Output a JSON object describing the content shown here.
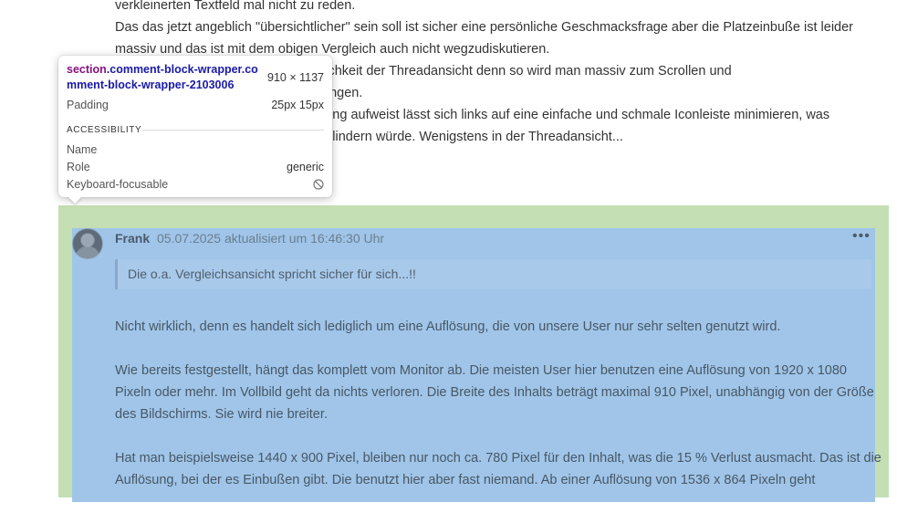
{
  "previous_comment": {
    "lines": [
      "verkleinerten Textfeld mal nicht zu reden.",
      "Das das jetzt angeblich \"übersichtlicher\" sein soll ist sicher eine persönliche Geschmacksfrage aber die Platzeinbuße ist leider",
      "massiv und das ist mit dem obigen Vergleich auch nicht wegzudiskutieren.",
      "lichkeit der Threadansicht denn so wird man massiv zum Scrollen und",
      "ungen.",
      "lung aufweist lässt sich links auf eine einfache und schmale Iconleiste minimieren, was",
      "s lindern würde. Wenigstens in der Threadansicht..."
    ]
  },
  "tooltip": {
    "selector_tag": "section",
    "selector_classes": ".comment-block-wrapper.comment-block-wrapper-2103006",
    "size": "910 × 1137",
    "padding_label": "Padding",
    "padding_value": "25px 15px",
    "accessibility_heading": "ACCESSIBILITY",
    "name_label": "Name",
    "name_value": "",
    "role_label": "Role",
    "role_value": "generic",
    "focusable_label": "Keyboard-focusable",
    "focusable_icon": "not-allowed-icon"
  },
  "comment": {
    "author": "Frank",
    "meta": "05.07.2025 aktualisiert um 16:46:30 Uhr",
    "more_label": "•••",
    "quote": "Die o.a. Vergleichsansicht spricht sicher für sich...!!",
    "paragraphs": [
      "Nicht wirklich, denn es handelt sich lediglich um eine Auflösung, die von unsere User nur sehr selten genutzt wird.",
      "Wie bereits festgestellt, hängt das komplett vom Monitor ab. Die meisten User hier benutzen eine Auflösung von 1920 x 1080 Pixeln oder mehr. Im Vollbild geht da nichts verloren. Die Breite des Inhalts beträgt maximal 910 Pixel, unabhängig von der Größe des Bildschirms. Sie wird nie breiter.",
      "Hat man beispielsweise 1440 x 900 Pixel, bleiben nur noch ca. 780 Pixel für den Inhalt, was die 15 % Verlust ausmacht. Das ist die Auflösung, bei der es Einbußen gibt. Die benutzt hier aber fast niemand. Ab einer Auflösung von 1536 x 864 Pixeln geht"
    ]
  },
  "colors": {
    "margin_highlight": "#c3dfb3",
    "padding_highlight": "#a0c5e8",
    "selector_tag": "#881280",
    "selector_class": "#1a1aa6"
  }
}
